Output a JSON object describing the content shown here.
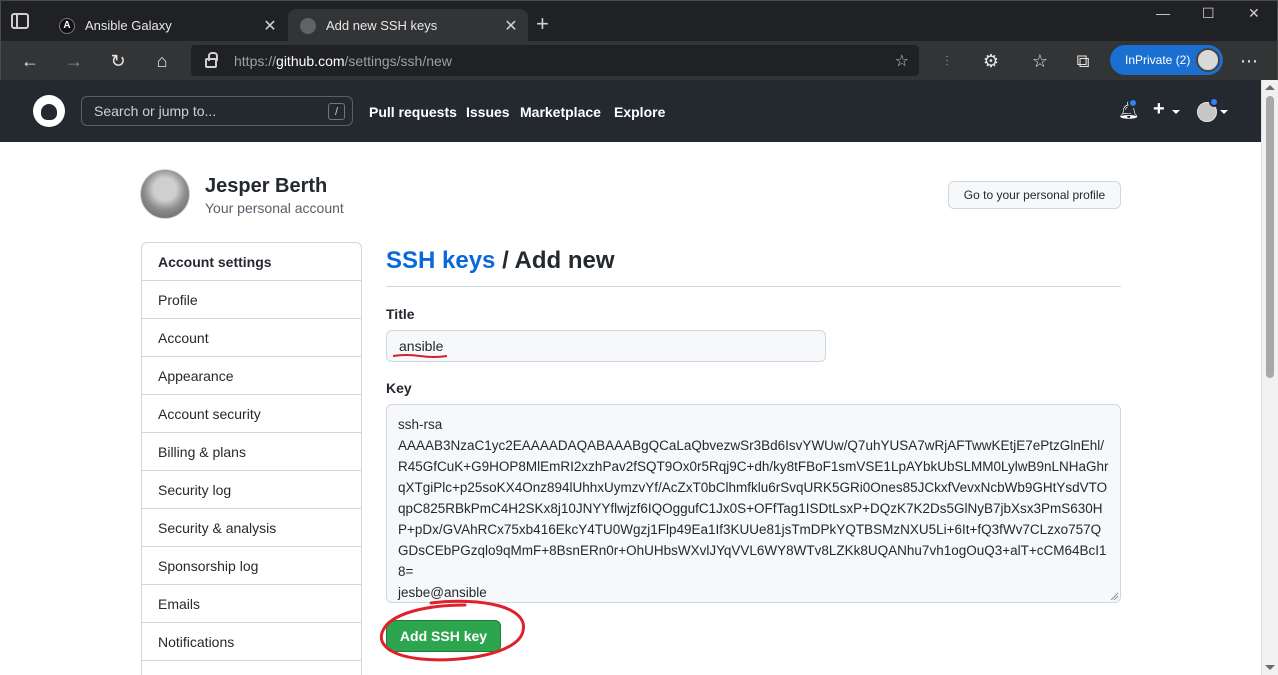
{
  "browser": {
    "tabs": [
      {
        "title": "Ansible Galaxy",
        "favicon": "A",
        "active": false
      },
      {
        "title": "Add new SSH keys",
        "active": true
      }
    ],
    "url_scheme": "https://",
    "url_host": "github.com",
    "url_path": "/settings/ssh/new",
    "inprivate_label": "InPrivate (2)"
  },
  "github_header": {
    "search_placeholder": "Search or jump to...",
    "search_shortcut": "/",
    "nav": [
      "Pull requests",
      "Issues",
      "Marketplace",
      "Explore"
    ]
  },
  "profile": {
    "name": "Jesper Berth",
    "subtitle": "Your personal account",
    "profile_button": "Go to your personal profile"
  },
  "sidebar": {
    "items": [
      {
        "label": "Account settings",
        "header": true
      },
      {
        "label": "Profile"
      },
      {
        "label": "Account"
      },
      {
        "label": "Appearance"
      },
      {
        "label": "Account security"
      },
      {
        "label": "Billing & plans"
      },
      {
        "label": "Security log"
      },
      {
        "label": "Security & analysis"
      },
      {
        "label": "Sponsorship log"
      },
      {
        "label": "Emails"
      },
      {
        "label": "Notifications"
      }
    ]
  },
  "main": {
    "breadcrumb_link": "SSH keys",
    "heading_suffix": " / Add new",
    "title_label": "Title",
    "title_value": "ansible",
    "key_label": "Key",
    "key_value": "ssh-rsa\nAAAAB3NzaC1yc2EAAAADAQABAAABgQCaLaQbvezwSr3Bd6IsvYWUw/Q7uhYUSA7wRjAFTwwKEtjE7ePtzGlnEhl/R45GfCuK+G9HOP8MlEmRI2xzhPav2fSQT9Ox0r5Rqj9C+dh/ky8tFBoF1smVSE1LpAYbkUbSLMM0LylwB9nLNHaGhrqXTgiPlc+p25soKX4Onz894lUhhxUymzvYf/AcZxT0bClhmfklu6rSvqURK5GRi0Ones85JCkxfVevxNcbWb9GHtYsdVTOqpC825RBkPmC4H2SKx8j10JNYYflwjzf6IQOggufC1Jx0S+OFfTag1ISDtLsxP+DQzK7K2Ds5GlNyB7jbXsx3PmS630HP+pDx/GVAhRCx75xb416EkcY4TU0Wgzj1Flp49Ea1If3KUUe81jsTmDPkYQTBSMzNXU5Li+6It+fQ3fWv7CLzxo757QGDsCEbPGzqlo9qMmF+8BsnERn0r+OhUHbsWXvlJYqVVL6WY8WTv8LZKk8UQANhu7vh1ogOuQ3+alT+cCM64BcI18=\njesbe@ansible",
    "submit_label": "Add SSH key"
  },
  "colors": {
    "github_header_bg": "#24292f",
    "link_blue": "#0969da",
    "primary_green": "#2da44e",
    "annotation_red": "#e0202a"
  }
}
